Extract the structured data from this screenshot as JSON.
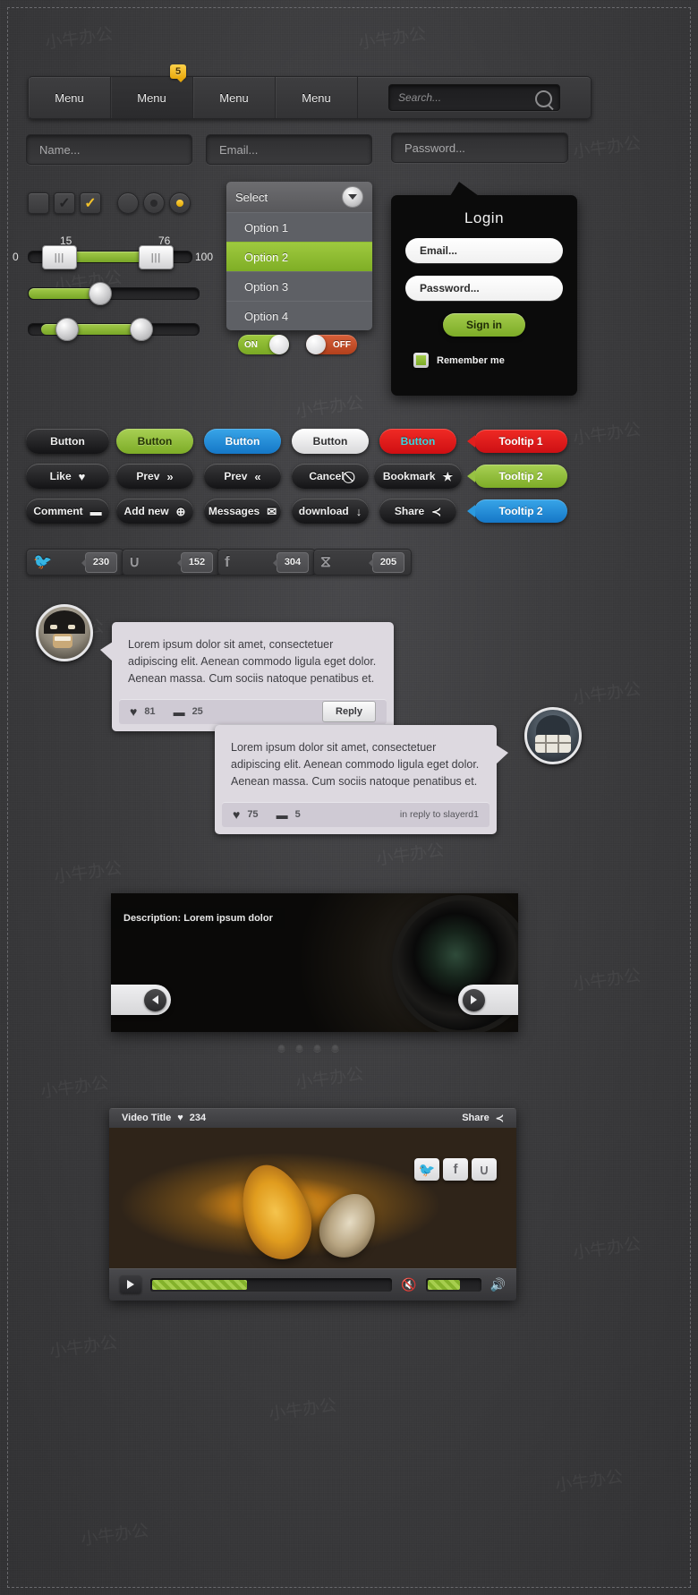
{
  "menu": {
    "items": [
      {
        "label": "Menu",
        "active": false
      },
      {
        "label": "Menu",
        "active": true
      },
      {
        "label": "Menu",
        "active": false
      },
      {
        "label": "Menu",
        "active": false
      }
    ],
    "badge": "5",
    "search_placeholder": "Search...",
    "search_icon": "magnifier-icon"
  },
  "inputs": {
    "name_placeholder": "Name...",
    "email_placeholder": "Email...",
    "password_placeholder": "Password..."
  },
  "checkboxes": [
    {
      "state": "empty",
      "mark": ""
    },
    {
      "state": "checked-dark",
      "mark": "✓"
    },
    {
      "state": "checked-yellow",
      "mark": "✓"
    }
  ],
  "radios": [
    {
      "state": "empty"
    },
    {
      "state": "dark"
    },
    {
      "state": "yellow"
    }
  ],
  "sliders": {
    "range": {
      "min_label": "0",
      "max_label": "100",
      "low_value": "15",
      "high_value": "76"
    },
    "single": {
      "value_percent": 44
    },
    "dual": {
      "left_percent": 24,
      "right_percent": 70
    }
  },
  "select": {
    "head_label": "Select",
    "caret_icon": "chevron-down-icon",
    "options": [
      {
        "label": "Option 1",
        "selected": false
      },
      {
        "label": "Option 2",
        "selected": true
      },
      {
        "label": "Option 3",
        "selected": false
      },
      {
        "label": "Option 4",
        "selected": false
      }
    ]
  },
  "toggles": [
    {
      "label": "ON",
      "state": "on"
    },
    {
      "label": "OFF",
      "state": "off"
    }
  ],
  "login": {
    "title": "Login",
    "email_placeholder": "Email...",
    "password_placeholder": "Password...",
    "signin_label": "Sign in",
    "remember_label": "Remember me",
    "remember_checked": true,
    "accent_color": "#8fbb32"
  },
  "buttons": {
    "row1": [
      {
        "label": "Button",
        "style": "dark"
      },
      {
        "label": "Button",
        "style": "green"
      },
      {
        "label": "Button",
        "style": "blue"
      },
      {
        "label": "Button",
        "style": "white"
      },
      {
        "label": "Button",
        "style": "red"
      }
    ],
    "row2": [
      {
        "label": "Like",
        "icon": "heart-icon",
        "glyph": "♥"
      },
      {
        "label": "Prev",
        "icon": "double-chevron-right-icon",
        "glyph": "»"
      },
      {
        "label": "Prev",
        "icon": "double-chevron-left-icon",
        "glyph": "«"
      },
      {
        "label": "Cancel",
        "icon": "no-entry-icon",
        "glyph": "⃠"
      },
      {
        "label": "Bookmark",
        "icon": "star-icon",
        "glyph": "★"
      }
    ],
    "row3": [
      {
        "label": "Comment",
        "icon": "speech-bubble-icon",
        "glyph": "▬"
      },
      {
        "label": "Add new",
        "icon": "plus-circle-icon",
        "glyph": "⊕"
      },
      {
        "label": "Messages",
        "icon": "envelope-icon",
        "glyph": "✉"
      },
      {
        "label": "download",
        "icon": "download-arrow-icon",
        "glyph": "↓"
      },
      {
        "label": "Share",
        "icon": "share-node-icon",
        "glyph": "≺"
      }
    ]
  },
  "tooltips": [
    {
      "label": "Tooltip 1",
      "style": "red"
    },
    {
      "label": "Tooltip 2",
      "style": "green"
    },
    {
      "label": "Tooltip 2",
      "style": "blue"
    }
  ],
  "social_counters": [
    {
      "network": "twitter",
      "icon": "twitter-bird-icon",
      "glyph": "🐦",
      "count": "230"
    },
    {
      "network": "stumbleupon",
      "icon": "stumbleupon-icon",
      "glyph": "∪",
      "count": "152"
    },
    {
      "network": "facebook",
      "icon": "facebook-f-icon",
      "glyph": "f",
      "count": "304"
    },
    {
      "network": "rss",
      "icon": "rss-icon",
      "glyph": "⧖",
      "count": "205"
    }
  ],
  "comments": [
    {
      "avatar": "batman-avatar",
      "side": "left",
      "text": "Lorem ipsum dolor sit amet, consectetuer adipiscing elit. Aenean commodo ligula eget dolor. Aenean massa. Cum sociis natoque penatibus et.",
      "likes": "81",
      "replies": "25",
      "action_label": "Reply"
    },
    {
      "avatar": "zombie-avatar",
      "side": "right",
      "text": "Lorem ipsum dolor sit amet, consectetuer adipiscing elit. Aenean commodo ligula eget dolor. Aenean massa. Cum sociis natoque penatibus et.",
      "likes": "75",
      "replies": "5",
      "action_label": "in reply to slayerd1"
    }
  ],
  "gallery": {
    "description": "Description: Lorem ipsum dolor",
    "prev_icon": "arrow-left-icon",
    "next_icon": "arrow-right-icon",
    "pagination_dots": 4,
    "active_dot_index": 0
  },
  "video": {
    "title": "Video Title",
    "like_icon": "heart-icon",
    "like_count": "234",
    "share_label": "Share",
    "share_icon": "share-node-icon",
    "social_buttons": [
      {
        "network": "twitter",
        "icon": "twitter-bird-icon",
        "glyph": "🐦"
      },
      {
        "network": "facebook",
        "icon": "facebook-f-icon",
        "glyph": "f"
      },
      {
        "network": "stumbleupon",
        "icon": "stumbleupon-icon",
        "glyph": "∪"
      }
    ],
    "play_icon": "play-icon",
    "mute_icon": "speaker-mute-icon",
    "volume_icon": "speaker-loud-icon",
    "progress_percent": 40,
    "volume_percent": 62
  },
  "watermark": "小牛办公"
}
